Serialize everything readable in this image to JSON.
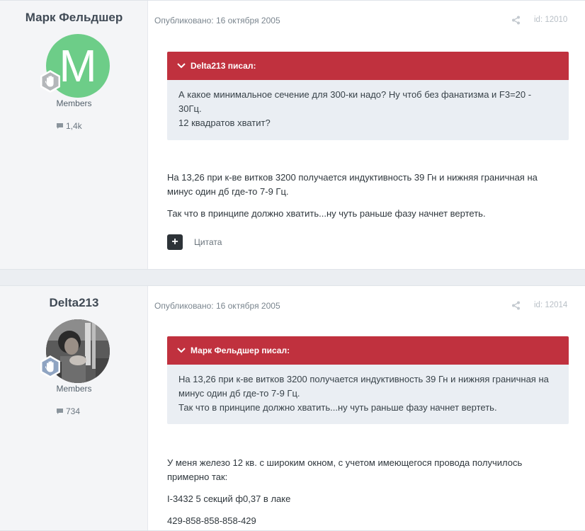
{
  "posts": [
    {
      "author": "Марк Фельдшер",
      "avatar_letter": "M",
      "group": "Members",
      "post_count": "1,4k",
      "published": "Опубликовано: 16 октября 2005",
      "post_id": "id: 12010",
      "quote": {
        "author_line": "Delta213 писал:",
        "lines": [
          "А какое минимальное сечение для 300-ки надо? Ну чтоб без фанатизма и F3=20 -",
          "30Гц.",
          "12 квадратов хватит?"
        ]
      },
      "body": [
        "На 13,26 при к-ве витков 3200 получается индуктивность 39 Гн и нижняя граничная на минус один дб где-то 7-9 Гц.",
        "Так что в принципе должно хватить...ну чуть раньше фазу начнет вертеть."
      ],
      "quote_button": "+",
      "quote_label": "Цитата"
    },
    {
      "author": "Delta213",
      "group": "Members",
      "post_count": "734",
      "published": "Опубликовано: 16 октября 2005",
      "post_id": "id: 12014",
      "quote": {
        "author_line": "Марк Фельдшер писал:",
        "lines": [
          "На 13,26 при к-ве витков 3200 получается индуктивность 39 Гн и нижняя граничная на",
          "минус один дб где-то 7-9 Гц.",
          "Так что в принципе должно хватить...ну чуть раньше фазу начнет вертеть."
        ]
      },
      "body": [
        "У меня железо 12 кв. с широким окном, с учетом имеющегося провода получилось примерно так:",
        "I-3432 5 секций ф0,37 в лаке",
        "429-858-858-858-429"
      ]
    }
  ],
  "icons": {
    "rank": "hand-badge-icon",
    "comments": "comment-bubble-icon",
    "share": "share-icon",
    "quote_toggle": "chevron-down-icon"
  },
  "colors": {
    "quote_header": "#c0313e",
    "avatar_green": "#6dcd88",
    "sidebar_bg": "#f4f5f7"
  }
}
